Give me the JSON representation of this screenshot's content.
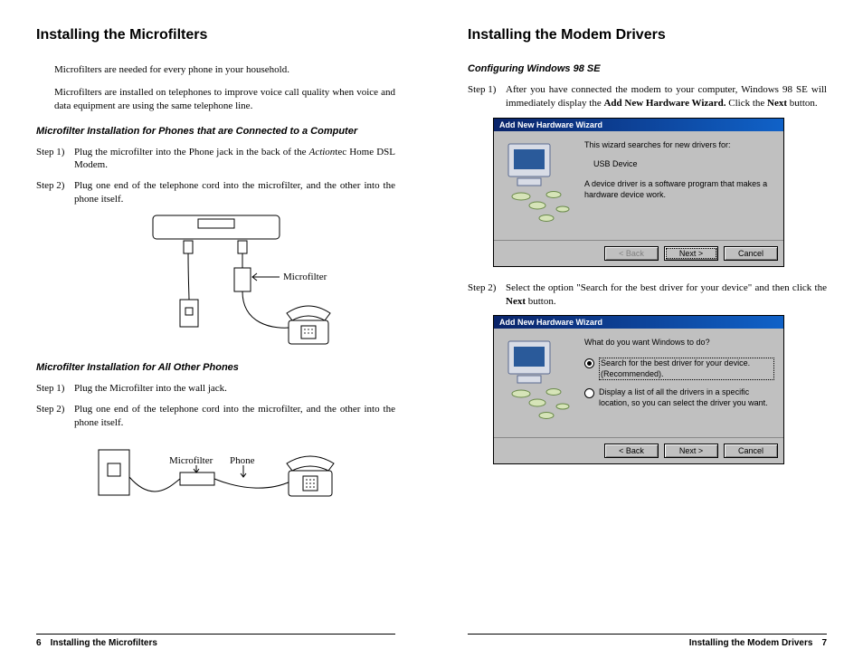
{
  "left": {
    "title": "Installing the Microfilters",
    "intro1": "Microfilters are needed for every phone in your household.",
    "intro2": "Microfilters are installed on telephones to improve voice call quality when voice and data equipment are using the same telephone line.",
    "sectionA_heading": "Microfilter Installation for Phones that are Connected to a Computer",
    "sectionA_step1_label": "Step 1)",
    "sectionA_step1_pre": "Plug the microfilter into the Phone jack in the back of the ",
    "sectionA_step1_italic": "Action",
    "sectionA_step1_post": "tec Home DSL Modem.",
    "sectionA_step2_label": "Step 2)",
    "sectionA_step2": "Plug one end of the telephone cord into the microfilter, and the other into the phone itself.",
    "diagramA_label": "Microfilter",
    "sectionB_heading": "Microfilter Installation for All Other Phones",
    "sectionB_step1_label": "Step 1)",
    "sectionB_step1": "Plug the Microfilter into the wall jack.",
    "sectionB_step2_label": "Step 2)",
    "sectionB_step2": "Plug one end of the telephone cord into the microfilter, and the other into the phone itself.",
    "diagramB_label1": "Microfilter",
    "diagramB_label2": "Phone",
    "footer_page": "6",
    "footer_title": "Installing the Microfilters"
  },
  "right": {
    "title": "Installing the Modem Drivers",
    "sectionC_heading": "Configuring Windows 98 SE",
    "step1_label": "Step 1)",
    "step1_a": "After you have connected the modem to your computer, Windows 98 SE will immediately display the ",
    "step1_bold": "Add New Hardware Wizard.",
    "step1_b": " Click the ",
    "step1_bold2": "Next",
    "step1_c": " button.",
    "dlg1_title": "Add New Hardware Wizard",
    "dlg1_line1": "This wizard searches for new drivers for:",
    "dlg1_line2": "USB Device",
    "dlg1_line3": "A device driver is a software program that makes a hardware device work.",
    "dlg1_back": "< Back",
    "dlg1_next": "Next >",
    "dlg1_cancel": "Cancel",
    "step2_label": "Step 2)",
    "step2_a": "Select the option \"Search for the best driver for your device\" and then click the ",
    "step2_bold": "Next",
    "step2_b": " button.",
    "dlg2_title": "Add New Hardware Wizard",
    "dlg2_prompt": "What do you want Windows to do?",
    "dlg2_opt1": "Search for the best driver for your device. (Recommended).",
    "dlg2_opt2": "Display a list of all the drivers in a specific location, so you can select the driver you want.",
    "dlg2_back": "< Back",
    "dlg2_next": "Next >",
    "dlg2_cancel": "Cancel",
    "footer_title": "Installing the Modem Drivers",
    "footer_page": "7"
  }
}
